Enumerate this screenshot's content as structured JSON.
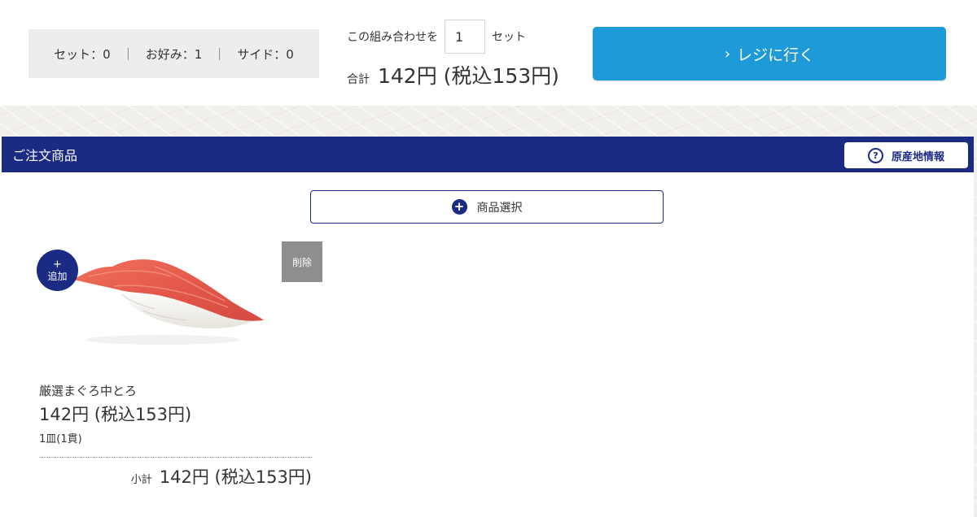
{
  "summary": {
    "set_label": "セット：0",
    "okonomi_label": "お好み：1",
    "side_label": "サイド：0",
    "separator": "｜"
  },
  "combo": {
    "prefix": "この組み合わせを",
    "quantity": "1",
    "suffix": "セット"
  },
  "total": {
    "label": "合計",
    "amount": "142円 (税込153円)"
  },
  "checkout": {
    "chevron": "›",
    "label": "レジに行く",
    "color": "#1f9ad9"
  },
  "order_section": {
    "title": "ご注文商品",
    "header_color": "#1b2a83",
    "origin_button": {
      "icon": "question-circle-icon",
      "glyph": "?",
      "label": "原産地情報"
    },
    "select_button": {
      "icon": "plus-circle-icon",
      "glyph": "+",
      "label": "商品選択"
    }
  },
  "item": {
    "image": "maguro-chutoro-nigiri",
    "add_button": {
      "plus": "+",
      "label": "追加"
    },
    "delete_label": "削除",
    "name": "厳選まぐろ中とろ",
    "price": "142円 (税込153円)",
    "portion": "1皿(1貫)",
    "subtotal_label": "小計",
    "subtotal_amount": "142円 (税込153円)"
  }
}
